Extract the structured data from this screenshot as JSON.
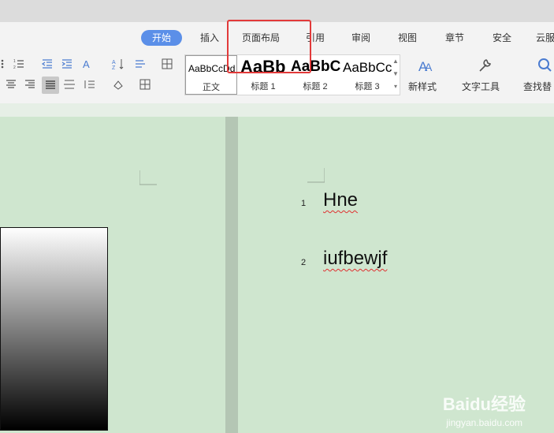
{
  "tabs": [
    {
      "label": "开始",
      "active": true
    },
    {
      "label": "插入"
    },
    {
      "label": "页面布局"
    },
    {
      "label": "引用"
    },
    {
      "label": "审阅"
    },
    {
      "label": "视图"
    },
    {
      "label": "章节"
    },
    {
      "label": "安全"
    },
    {
      "label": "云服"
    }
  ],
  "styles": [
    {
      "preview": "AaBbCcDd",
      "label": "正文"
    },
    {
      "preview": "AaBb",
      "label": "标题 1"
    },
    {
      "preview": "AaBbC",
      "label": "标题 2"
    },
    {
      "preview": "AaBbCc",
      "label": "标题 3"
    }
  ],
  "new_style_label": "新样式",
  "text_tools_label": "文字工具",
  "find_replace_label": "查找替",
  "lines": [
    {
      "num": "1",
      "text": "Hne"
    },
    {
      "num": "2",
      "text": "iufbewjf"
    }
  ],
  "watermark": {
    "brand": "Baidu经验",
    "url": "jingyan.baidu.com"
  },
  "colors": {
    "accent": "#5b8fe8",
    "highlight_box": "#e23a3a",
    "doc_bg": "#cfe6cf"
  }
}
